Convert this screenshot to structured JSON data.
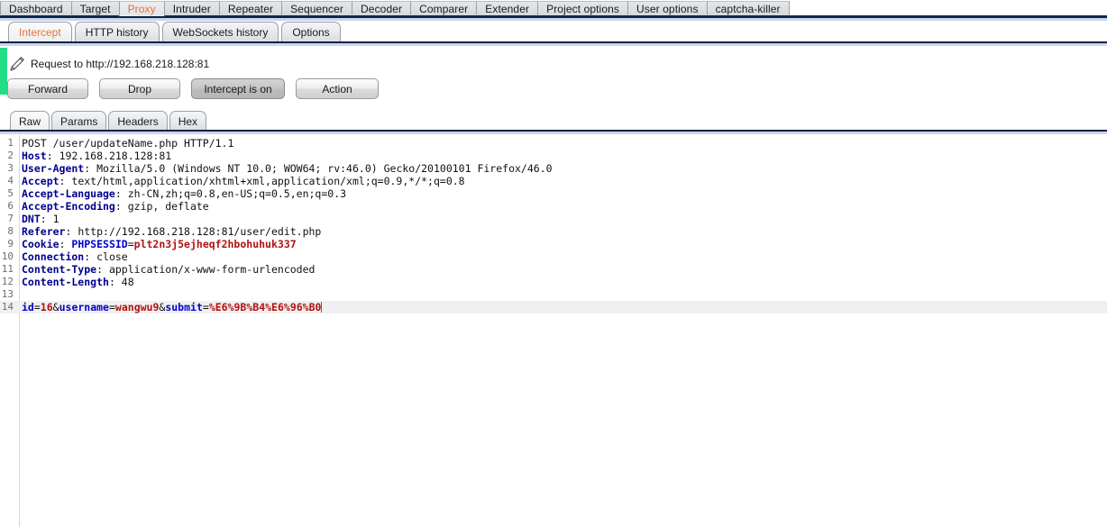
{
  "window": {
    "accent_orange": "#e8703c",
    "separator_navy": "#0d2246",
    "separator_blue": "#c8d6ea",
    "marker_green": "#22dd85"
  },
  "main_tabs": [
    {
      "label": "Dashboard",
      "selected": false
    },
    {
      "label": "Target",
      "selected": false
    },
    {
      "label": "Proxy",
      "selected": true
    },
    {
      "label": "Intruder",
      "selected": false
    },
    {
      "label": "Repeater",
      "selected": false
    },
    {
      "label": "Sequencer",
      "selected": false
    },
    {
      "label": "Decoder",
      "selected": false
    },
    {
      "label": "Comparer",
      "selected": false
    },
    {
      "label": "Extender",
      "selected": false
    },
    {
      "label": "Project options",
      "selected": false
    },
    {
      "label": "User options",
      "selected": false
    },
    {
      "label": "captcha-killer",
      "selected": false
    }
  ],
  "sub_tabs": [
    {
      "label": "Intercept",
      "selected": true
    },
    {
      "label": "HTTP history",
      "selected": false
    },
    {
      "label": "WebSockets history",
      "selected": false
    },
    {
      "label": "Options",
      "selected": false
    }
  ],
  "request_bar": {
    "icon": "pencil-icon",
    "label": "Request to http://192.168.218.128:81"
  },
  "buttons": {
    "forward": "Forward",
    "drop": "Drop",
    "intercept_toggle": "Intercept is on",
    "action": "Action"
  },
  "editor_tabs": [
    {
      "label": "Raw",
      "selected": true
    },
    {
      "label": "Params",
      "selected": false
    },
    {
      "label": "Headers",
      "selected": false
    },
    {
      "label": "Hex",
      "selected": false
    }
  ],
  "request": {
    "lines": [
      {
        "n": "1",
        "segments": [
          {
            "t": "POST /user/updateName.php HTTP/1.1",
            "c": "pl"
          }
        ]
      },
      {
        "n": "2",
        "segments": [
          {
            "t": "Host",
            "c": "k"
          },
          {
            "t": ": ",
            "c": "pl"
          },
          {
            "t": "192.168.218.128:81",
            "c": "v"
          }
        ]
      },
      {
        "n": "3",
        "segments": [
          {
            "t": "User-Agent",
            "c": "k"
          },
          {
            "t": ": ",
            "c": "pl"
          },
          {
            "t": "Mozilla/5.0 (Windows NT 10.0; WOW64; rv:46.0) Gecko/20100101 Firefox/46.0",
            "c": "v"
          }
        ]
      },
      {
        "n": "4",
        "segments": [
          {
            "t": "Accept",
            "c": "k"
          },
          {
            "t": ": ",
            "c": "pl"
          },
          {
            "t": "text/html,application/xhtml+xml,application/xml;q=0.9,*/*;q=0.8",
            "c": "v"
          }
        ]
      },
      {
        "n": "5",
        "segments": [
          {
            "t": "Accept-Language",
            "c": "k"
          },
          {
            "t": ": ",
            "c": "pl"
          },
          {
            "t": "zh-CN,zh;q=0.8,en-US;q=0.5,en;q=0.3",
            "c": "v"
          }
        ]
      },
      {
        "n": "6",
        "segments": [
          {
            "t": "Accept-Encoding",
            "c": "k"
          },
          {
            "t": ": ",
            "c": "pl"
          },
          {
            "t": "gzip, deflate",
            "c": "v"
          }
        ]
      },
      {
        "n": "7",
        "segments": [
          {
            "t": "DNT",
            "c": "k"
          },
          {
            "t": ": ",
            "c": "pl"
          },
          {
            "t": "1",
            "c": "v"
          }
        ]
      },
      {
        "n": "8",
        "segments": [
          {
            "t": "Referer",
            "c": "k"
          },
          {
            "t": ": ",
            "c": "pl"
          },
          {
            "t": "http://192.168.218.128:81/user/edit.php",
            "c": "v"
          }
        ]
      },
      {
        "n": "9",
        "segments": [
          {
            "t": "Cookie",
            "c": "k"
          },
          {
            "t": ": ",
            "c": "pl"
          },
          {
            "t": "PHPSESSID",
            "c": "kb"
          },
          {
            "t": "=",
            "c": "pl"
          },
          {
            "t": "plt2n3j5ejheqf2hbohuhuk337",
            "c": "rd"
          }
        ]
      },
      {
        "n": "10",
        "segments": [
          {
            "t": "Connection",
            "c": "k"
          },
          {
            "t": ": ",
            "c": "pl"
          },
          {
            "t": "close",
            "c": "v"
          }
        ]
      },
      {
        "n": "11",
        "segments": [
          {
            "t": "Content-Type",
            "c": "k"
          },
          {
            "t": ": ",
            "c": "pl"
          },
          {
            "t": "application/x-www-form-urlencoded",
            "c": "v"
          }
        ]
      },
      {
        "n": "12",
        "segments": [
          {
            "t": "Content-Length",
            "c": "k"
          },
          {
            "t": ": ",
            "c": "pl"
          },
          {
            "t": "48",
            "c": "v"
          }
        ]
      },
      {
        "n": "13",
        "segments": []
      },
      {
        "n": "14",
        "active": true,
        "caret": true,
        "segments": [
          {
            "t": "id",
            "c": "kb"
          },
          {
            "t": "=",
            "c": "pl"
          },
          {
            "t": "16",
            "c": "rd"
          },
          {
            "t": "&",
            "c": "pl"
          },
          {
            "t": "username",
            "c": "kb"
          },
          {
            "t": "=",
            "c": "pl"
          },
          {
            "t": "wangwu9",
            "c": "rd"
          },
          {
            "t": "&",
            "c": "pl"
          },
          {
            "t": "submit",
            "c": "kb"
          },
          {
            "t": "=",
            "c": "pl"
          },
          {
            "t": "%E6%9B%B4%E6%96%B0",
            "c": "rd"
          }
        ]
      }
    ]
  }
}
